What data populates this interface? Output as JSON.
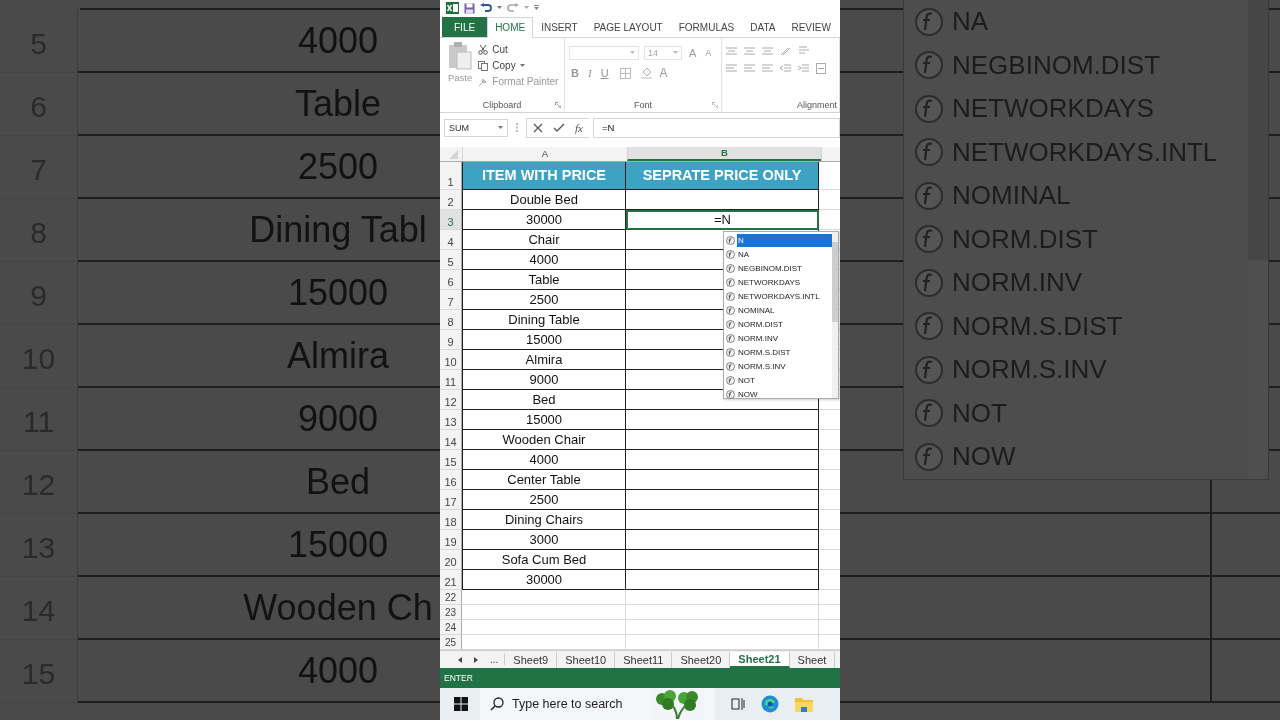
{
  "left_zoom": {
    "rows": [
      {
        "number": "5",
        "value": "4000"
      },
      {
        "number": "6",
        "value": "Table"
      },
      {
        "number": "7",
        "value": "2500"
      },
      {
        "number": "8",
        "value": "Dining Tabl"
      },
      {
        "number": "9",
        "value": "15000"
      },
      {
        "number": "10",
        "value": "Almira"
      },
      {
        "number": "11",
        "value": "9000"
      },
      {
        "number": "12",
        "value": "Bed"
      },
      {
        "number": "13",
        "value": "15000"
      },
      {
        "number": "14",
        "value": "Wooden Ch"
      },
      {
        "number": "15",
        "value": "4000"
      }
    ]
  },
  "excel": {
    "ribbon_tabs": [
      {
        "label": "FILE",
        "kind": "file",
        "selected": false
      },
      {
        "label": "HOME",
        "kind": "tab",
        "selected": true
      },
      {
        "label": "INSERT",
        "kind": "tab",
        "selected": false
      },
      {
        "label": "PAGE LAYOUT",
        "kind": "tab",
        "selected": false
      },
      {
        "label": "FORMULAS",
        "kind": "tab",
        "selected": false
      },
      {
        "label": "DATA",
        "kind": "tab",
        "selected": false
      },
      {
        "label": "REVIEW",
        "kind": "tab",
        "selected": false
      }
    ],
    "clipboard": {
      "paste": "Paste",
      "cut": "Cut",
      "copy": "Copy",
      "format_painter": "Format Painter",
      "label": "Clipboard"
    },
    "font": {
      "size": "14",
      "grow": "A",
      "shrink": "A",
      "bold": "B",
      "italic": "I",
      "underline": "U",
      "font_color": "A",
      "label": "Font"
    },
    "alignment": {
      "label": "Alignment"
    },
    "name_box": "SUM",
    "function_label": "fx",
    "formula": "=N",
    "columns": [
      {
        "label": "A",
        "selected": false
      },
      {
        "label": "B",
        "selected": true
      }
    ],
    "rows": [
      {
        "number": "1",
        "kind": "header",
        "selected": false,
        "a": "ITEM WITH PRICE",
        "b": "SEPRATE PRICE ONLY"
      },
      {
        "number": "2",
        "kind": "data",
        "selected": false,
        "a": "Double Bed"
      },
      {
        "number": "3",
        "kind": "data",
        "selected": true,
        "a": "30000",
        "b": "=N"
      },
      {
        "number": "4",
        "kind": "data",
        "selected": false,
        "a": "Chair"
      },
      {
        "number": "5",
        "kind": "data",
        "selected": false,
        "a": "4000"
      },
      {
        "number": "6",
        "kind": "data",
        "selected": false,
        "a": "Table"
      },
      {
        "number": "7",
        "kind": "data",
        "selected": false,
        "a": "2500"
      },
      {
        "number": "8",
        "kind": "data",
        "selected": false,
        "a": "Dining Table"
      },
      {
        "number": "9",
        "kind": "data",
        "selected": false,
        "a": "15000"
      },
      {
        "number": "10",
        "kind": "data",
        "selected": false,
        "a": "Almira"
      },
      {
        "number": "11",
        "kind": "data",
        "selected": false,
        "a": "9000"
      },
      {
        "number": "12",
        "kind": "data",
        "selected": false,
        "a": "Bed"
      },
      {
        "number": "13",
        "kind": "data",
        "selected": false,
        "a": "15000"
      },
      {
        "number": "14",
        "kind": "data",
        "selected": false,
        "a": "Wooden Chair"
      },
      {
        "number": "15",
        "kind": "data",
        "selected": false,
        "a": "4000"
      },
      {
        "number": "16",
        "kind": "data",
        "selected": false,
        "a": "Center Table"
      },
      {
        "number": "17",
        "kind": "data",
        "selected": false,
        "a": "2500"
      },
      {
        "number": "18",
        "kind": "data",
        "selected": false,
        "a": "Dining Chairs"
      },
      {
        "number": "19",
        "kind": "data",
        "selected": false,
        "a": "3000"
      },
      {
        "number": "20",
        "kind": "data",
        "selected": false,
        "a": "Sofa Cum Bed"
      },
      {
        "number": "21",
        "kind": "data",
        "selected": false,
        "a": "30000"
      },
      {
        "number": "22",
        "kind": "empty",
        "selected": false
      },
      {
        "number": "23",
        "kind": "empty",
        "selected": false
      },
      {
        "number": "24",
        "kind": "empty",
        "selected": false
      },
      {
        "number": "25",
        "kind": "empty",
        "selected": false
      }
    ],
    "autocomplete": [
      {
        "name": "N",
        "selected": true
      },
      {
        "name": "NA",
        "selected": false
      },
      {
        "name": "NEGBINOM.DIST",
        "selected": false
      },
      {
        "name": "NETWORKDAYS",
        "selected": false
      },
      {
        "name": "NETWORKDAYS.INTL",
        "selected": false
      },
      {
        "name": "NOMINAL",
        "selected": false
      },
      {
        "name": "NORM.DIST",
        "selected": false
      },
      {
        "name": "NORM.INV",
        "selected": false
      },
      {
        "name": "NORM.S.DIST",
        "selected": false
      },
      {
        "name": "NORM.S.INV",
        "selected": false
      },
      {
        "name": "NOT",
        "selected": false
      },
      {
        "name": "NOW",
        "selected": false
      }
    ],
    "sheet_more": "...",
    "sheet_tabs": [
      {
        "label": "Sheet9",
        "selected": false
      },
      {
        "label": "Sheet10",
        "selected": false
      },
      {
        "label": "Sheet11",
        "selected": false
      },
      {
        "label": "Sheet20",
        "selected": false
      },
      {
        "label": "Sheet21",
        "selected": true
      },
      {
        "label": "Sheet",
        "selected": false
      }
    ],
    "status": "ENTER"
  },
  "taskbar": {
    "search_placeholder": "Type here to search"
  },
  "right_zoom": {
    "functions": [
      "NA",
      "NEGBINOM.DIST",
      "NETWORKDAYS",
      "NETWORKDAYS.INTL",
      "NOMINAL",
      "NORM.DIST",
      "NORM.INV",
      "NORM.S.DIST",
      "NORM.S.INV",
      "NOT",
      "NOW"
    ]
  }
}
